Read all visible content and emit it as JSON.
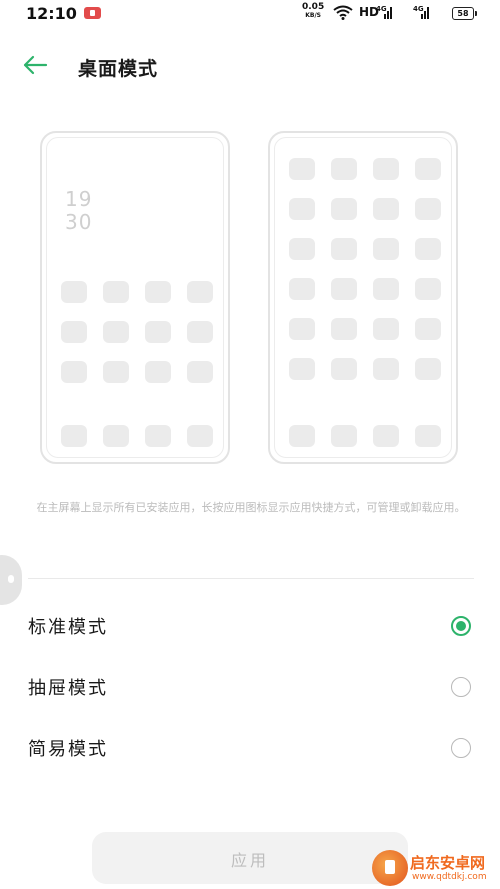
{
  "status_bar": {
    "time": "12:10",
    "net_speed": "0.05",
    "net_speed_unit": "KB/S",
    "hd_label": "HD",
    "signal_labels": [
      "4G",
      "4G"
    ],
    "battery": "58",
    "rec_color": "#e24b4b"
  },
  "header": {
    "back_icon": "arrow-left-icon",
    "title": "桌面模式",
    "accent": "#2db36b"
  },
  "preview": {
    "standard_clock_hour": "19",
    "standard_clock_minute": "30"
  },
  "description": "在主屏幕上显示所有已安装应用，长按应用图标显示应用快捷方式，可管理或卸载应用。",
  "modes": [
    {
      "label": "标准模式",
      "selected": true
    },
    {
      "label": "抽屉模式",
      "selected": false
    },
    {
      "label": "简易模式",
      "selected": false
    }
  ],
  "apply_button": {
    "label": "应用"
  },
  "watermark": {
    "title": "启东安卓网",
    "url": "www.qdtdkj.com"
  }
}
